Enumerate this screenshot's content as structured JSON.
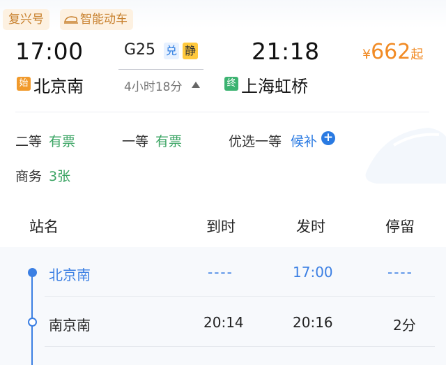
{
  "tags": {
    "type": "复兴号",
    "smart": "智能动车"
  },
  "train": {
    "number": "G25",
    "badge_dui": "兑",
    "badge_jing": "静",
    "duration": "4小时18分"
  },
  "departure": {
    "time": "17:00",
    "station": "北京南",
    "icon": "始"
  },
  "arrival": {
    "time": "21:18",
    "station": "上海虹桥",
    "icon": "终"
  },
  "price": {
    "currency": "¥",
    "amount": "662",
    "suffix": "起"
  },
  "seats": [
    {
      "label": "二等",
      "status": "有票"
    },
    {
      "label": "一等",
      "status": "有票"
    },
    {
      "label": "优选一等",
      "status": "候补"
    },
    {
      "label": "商务",
      "status": "3张"
    }
  ],
  "table": {
    "headers": [
      "站名",
      "到时",
      "发时",
      "停留"
    ],
    "rows": [
      {
        "station": "北京南",
        "arrive": "----",
        "depart": "17:00",
        "stop": "----"
      },
      {
        "station": "南京南",
        "arrive": "20:14",
        "depart": "20:16",
        "stop": "2分"
      }
    ]
  },
  "colors": {
    "accent": "#3b7fe3",
    "price": "#f18b25",
    "available": "#3aa463",
    "tag": "#c8812e"
  }
}
